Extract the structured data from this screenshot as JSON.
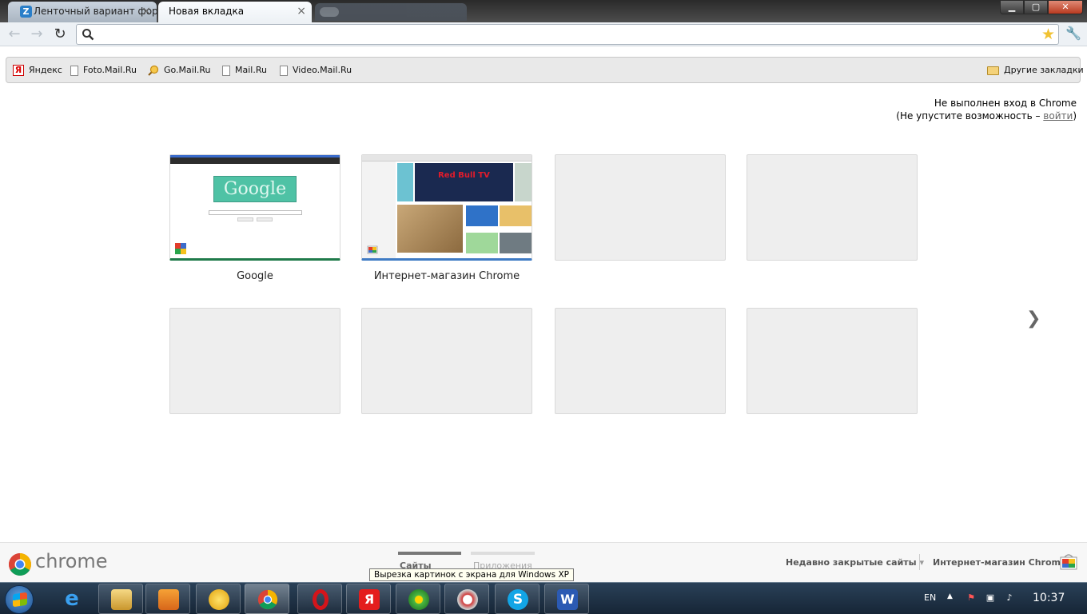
{
  "tabs": [
    {
      "label": "Ленточный вариант фору",
      "icon": "Z",
      "active": false
    },
    {
      "label": "Новая вкладка",
      "active": true
    }
  ],
  "window_controls": {
    "minimize": "▁",
    "maximize": "▢",
    "close": "✕"
  },
  "toolbar": {
    "back": "←",
    "forward": "→",
    "reload": "↻",
    "omnibox_value": "",
    "star": "★",
    "wrench": "🔧"
  },
  "bookmarks": [
    {
      "label": "Яндекс",
      "icon": "yandex"
    },
    {
      "label": "Foto.Mail.Ru",
      "icon": "page"
    },
    {
      "label": "Go.Mail.Ru",
      "icon": "search"
    },
    {
      "label": "Mail.Ru",
      "icon": "page"
    },
    {
      "label": "Video.Mail.Ru",
      "icon": "page"
    }
  ],
  "other_bookmarks": "Другие закладки",
  "signin": {
    "line1": "Не выполнен вход в Chrome",
    "line2_prefix": "(Не упустите возможность –",
    "link": "войти",
    "line2_suffix": ")"
  },
  "most_visited": [
    {
      "title": "Google"
    },
    {
      "title": "Интернет-магазин Chrome"
    }
  ],
  "store_thumb": {
    "banner": "Red Bull TV"
  },
  "google_thumb": {
    "doodle": "Google"
  },
  "next_arrow": "❯",
  "footer": {
    "logo_text": "chrome",
    "pages": [
      {
        "label": "Сайты",
        "selected": true
      },
      {
        "label": "Приложения",
        "selected": false
      }
    ],
    "recently_closed": "Недавно закрытые сайты",
    "store_link": "Интернет-магазин Chrome"
  },
  "tooltip": "Вырезка картинок с экрана для Windows XP",
  "taskbar": {
    "lang": "EN",
    "clock": "10:37",
    "apps": [
      "internet-explorer",
      "explorer",
      "media-player",
      "globe",
      "chrome",
      "opera",
      "yandex",
      "icq",
      "snipping-tool",
      "skype",
      "word"
    ]
  },
  "colors": {
    "accent": "#3f7bc4",
    "tab_bar": "#2a2a2a"
  }
}
